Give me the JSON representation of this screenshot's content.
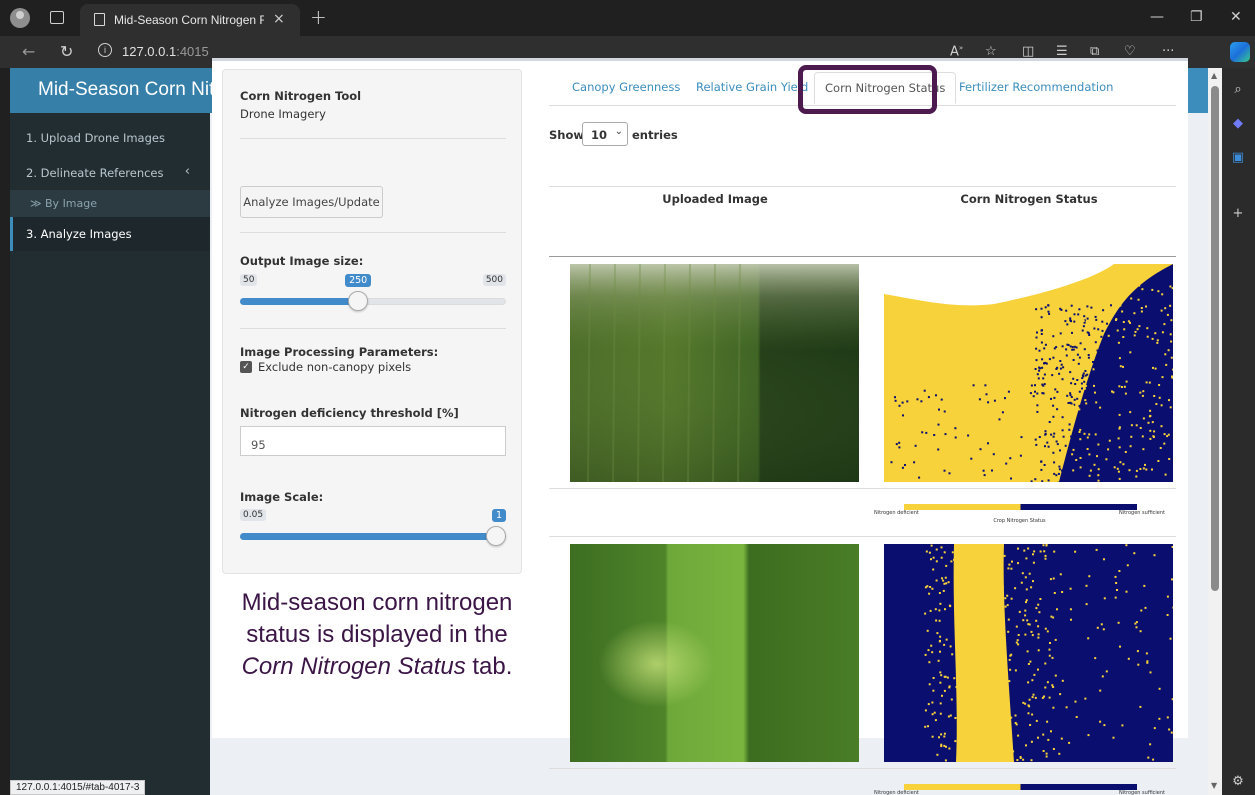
{
  "browser": {
    "tab_title": "Mid-Season Corn Nitrogen Fertil",
    "tab_close": "×",
    "new_tab": "+",
    "url_host": "127.0.0.1",
    "url_port": ":4015",
    "status_url": "127.0.0.1:4015/#tab-4017-3"
  },
  "header": {
    "title": "Mid-Season Corn Nitrogen Fertilizer Management Tool",
    "menu_icon": "hamburger-icon"
  },
  "sidebar": {
    "items": [
      {
        "label": "1. Upload Drone Images"
      },
      {
        "label": "2. Delineate References"
      },
      {
        "label": "≫ By Image"
      },
      {
        "label": "3. Analyze Images"
      }
    ]
  },
  "panel": {
    "tool_title": "Corn Nitrogen Tool",
    "tool_subtitle": "Drone Imagery",
    "analyze_button": "Analyze Images/Update",
    "output_size_label": "Output Image size:",
    "output_size": {
      "min": "50",
      "value": "250",
      "max": "500",
      "fraction": 0.444
    },
    "processing_label": "Image Processing Parameters:",
    "exclude_label": "Exclude non-canopy pixels",
    "exclude_checked": true,
    "threshold_label": "Nitrogen deficiency threshold [%]",
    "threshold_value": "95",
    "scale_label": "Image Scale:",
    "scale": {
      "min": "0.05",
      "value": "1",
      "fraction": 1.0
    }
  },
  "annotation": {
    "line1": "Mid-season corn nitrogen",
    "line2": "status is displayed in the",
    "line3_italic": "Corn Nitrogen Status",
    "line3_rest": " tab."
  },
  "tabs": [
    {
      "label": "Canopy Greenness"
    },
    {
      "label": "Relative Grain Yield"
    },
    {
      "label": "Corn Nitrogen Status"
    },
    {
      "label": "Fertilizer Recommendation"
    }
  ],
  "table": {
    "show": "Show",
    "entries_value": "10",
    "entries": "entries",
    "columns": [
      "Uploaded Image",
      "Corn Nitrogen Status"
    ],
    "colorbar": {
      "left": "Nitrogen deficient",
      "right": "Nitrogen sufficient",
      "title": "Crop Nitrogen Status"
    }
  },
  "colors": {
    "header": "#3c8dbc",
    "logo": "#367fa9",
    "sidebar": "#222d32",
    "deficient": "#f7d23a",
    "sufficient": "#0a0e6e",
    "highlight": "#4d1a50"
  }
}
